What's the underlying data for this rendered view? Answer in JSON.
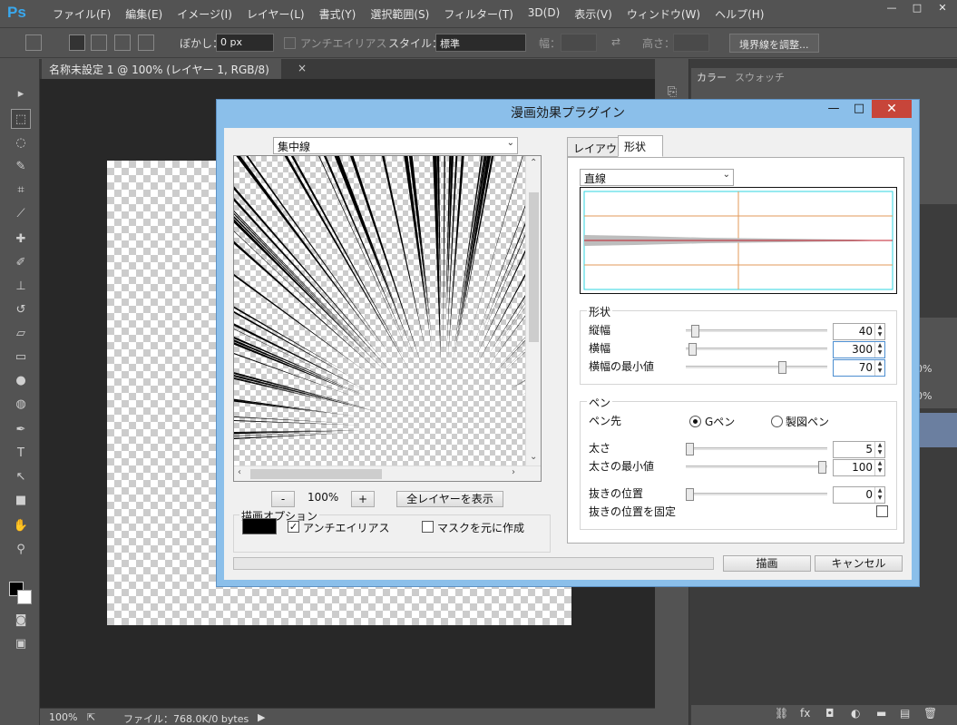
{
  "app": {
    "logo": "Ps",
    "menu": [
      "ファイル(F)",
      "編集(E)",
      "イメージ(I)",
      "レイヤー(L)",
      "書式(Y)",
      "選択範囲(S)",
      "フィルター(T)",
      "3D(D)",
      "表示(V)",
      "ウィンドウ(W)",
      "ヘルプ(H)"
    ],
    "window_controls": [
      "—",
      "□",
      "✕"
    ]
  },
  "options_bar": {
    "feather_label": "ぼかし：",
    "feather_value": "0 px",
    "antialias_label": "アンチエイリアス",
    "style_label": "スタイル：",
    "style_value": "標準",
    "width_label": "幅：",
    "height_label": "高さ：",
    "refine_button": "境界線を調整..."
  },
  "document": {
    "tab_title": "名称未設定 1 @ 100% (レイヤー 1, RGB/8)",
    "tab_close": "×"
  },
  "status_bar": {
    "zoom": "100%",
    "file_info": "ファイル：768.0K/0 bytes"
  },
  "panels": {
    "color_tab": "カラー",
    "swatch_tab": "スウォッチ",
    "opacity_1": "0%",
    "opacity_2": "0%"
  },
  "dialog": {
    "title": "漫画効果プラグイン",
    "effect_select": "集中線",
    "zoom_minus": "-",
    "zoom_value": "100%",
    "zoom_plus": "+",
    "show_all_layers": "全レイヤーを表示",
    "draw_options_label": "描画オプション",
    "draw_color": "#000000",
    "antialias_label": "アンチエイリアス",
    "antialias_checked": true,
    "mask_label": "マスクを元に作成",
    "mask_checked": false,
    "tabs": [
      "レイアウト",
      "形状"
    ],
    "active_tab": "形状",
    "shape_select": "直線",
    "shape_group": {
      "title": "形状",
      "rows": [
        {
          "label": "縦幅",
          "value": "40",
          "level": 0.04
        },
        {
          "label": "横幅",
          "value": "300",
          "level": 0.02
        },
        {
          "label": "横幅の最小値",
          "value": "70",
          "level": 0.7
        }
      ]
    },
    "pen_group": {
      "title": "ペン",
      "nib_label": "ペン先",
      "nib_options": [
        "Gペン",
        "製図ペン"
      ],
      "nib_selected": "Gペン",
      "rows": [
        {
          "label": "太さ",
          "value": "5",
          "level": 0.0
        },
        {
          "label": "太さの最小値",
          "value": "100",
          "level": 1.0
        },
        {
          "label": "抜きの位置",
          "value": "0",
          "level": 0.0
        }
      ],
      "fix_label": "抜きの位置を固定",
      "fix_checked": false
    },
    "draw_button": "描画",
    "cancel_button": "キャンセル"
  }
}
